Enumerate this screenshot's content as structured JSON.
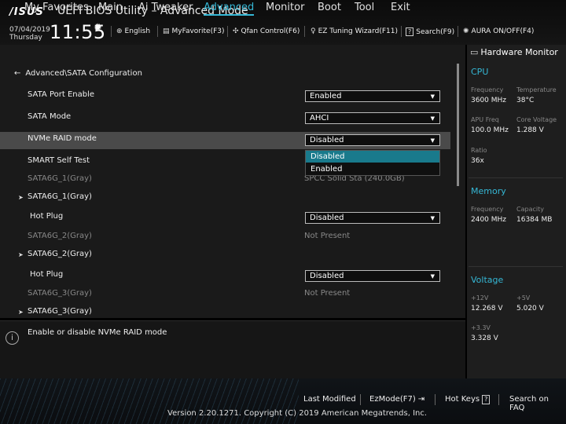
{
  "header": {
    "logo": "/ISUS",
    "title": "UEFI BIOS Utility – Advanced Mode",
    "date": "07/04/2019",
    "day": "Thursday",
    "time": "11:55",
    "tools": [
      {
        "icon": "globe-icon",
        "label": "English"
      },
      {
        "icon": "favorite-icon",
        "label": "MyFavorite(F3)"
      },
      {
        "icon": "fan-icon",
        "label": "Qfan Control(F6)"
      },
      {
        "icon": "bulb-icon",
        "label": "EZ Tuning Wizard(F11)"
      },
      {
        "icon": "question-icon",
        "label": "Search(F9)"
      },
      {
        "icon": "aura-icon",
        "label": "AURA ON/OFF(F4)"
      }
    ]
  },
  "nav": {
    "tabs": [
      "My Favorites",
      "Main",
      "Ai Tweaker",
      "Advanced",
      "Monitor",
      "Boot",
      "Tool",
      "Exit"
    ],
    "active": "Advanced"
  },
  "breadcrumb": "Advanced\\SATA Configuration",
  "settings": {
    "sata_port_enable": {
      "label": "SATA Port Enable",
      "value": "Enabled"
    },
    "sata_mode": {
      "label": "SATA Mode",
      "value": "AHCI"
    },
    "nvme_raid": {
      "label": "NVMe RAID mode",
      "value": "Disabled"
    },
    "smart_self_test": {
      "label": "SMART Self Test"
    },
    "sata6g_1_gray": {
      "label": "SATA6G_1(Gray)",
      "value": "SPCC Solid Sta (240.0GB)"
    },
    "sata6g_1_expand": {
      "label": "SATA6G_1(Gray)"
    },
    "hot_plug_1": {
      "label": "Hot Plug",
      "value": "Disabled"
    },
    "sata6g_2_gray": {
      "label": "SATA6G_2(Gray)",
      "value": "Not Present"
    },
    "sata6g_2_expand": {
      "label": "SATA6G_2(Gray)"
    },
    "hot_plug_2": {
      "label": "Hot Plug",
      "value": "Disabled"
    },
    "sata6g_3_gray": {
      "label": "SATA6G_3(Gray)",
      "value": "Not Present"
    },
    "sata6g_3_expand": {
      "label": "SATA6G_3(Gray)"
    }
  },
  "dropdown": {
    "options": [
      "Disabled",
      "Enabled"
    ],
    "highlighted": "Disabled"
  },
  "help": "Enable or disable NVMe RAID mode",
  "hardware_monitor": {
    "title": "Hardware Monitor",
    "cpu": {
      "heading": "CPU",
      "frequency_label": "Frequency",
      "frequency": "3600 MHz",
      "temperature_label": "Temperature",
      "temperature": "38°C",
      "apu_freq_label": "APU Freq",
      "apu_freq": "100.0 MHz",
      "core_voltage_label": "Core Voltage",
      "core_voltage": "1.288 V",
      "ratio_label": "Ratio",
      "ratio": "36x"
    },
    "memory": {
      "heading": "Memory",
      "frequency_label": "Frequency",
      "frequency": "2400 MHz",
      "capacity_label": "Capacity",
      "capacity": "16384 MB"
    },
    "voltage": {
      "heading": "Voltage",
      "v12_label": "+12V",
      "v12": "12.268 V",
      "v5_label": "+5V",
      "v5": "5.020 V",
      "v33_label": "+3.3V",
      "v33": "3.328 V"
    }
  },
  "footer": {
    "last_modified": "Last Modified",
    "ezmode": "EzMode(F7)",
    "hot_keys": "Hot Keys",
    "hot_keys_key": "?",
    "search_faq": "Search on FAQ",
    "copyright": "Version 2.20.1271. Copyright (C) 2019 American Megatrends, Inc."
  },
  "colors": {
    "accent": "#35b8d6",
    "highlight_row": "#4a4a4a",
    "dropdown_selected": "#197a8c"
  }
}
